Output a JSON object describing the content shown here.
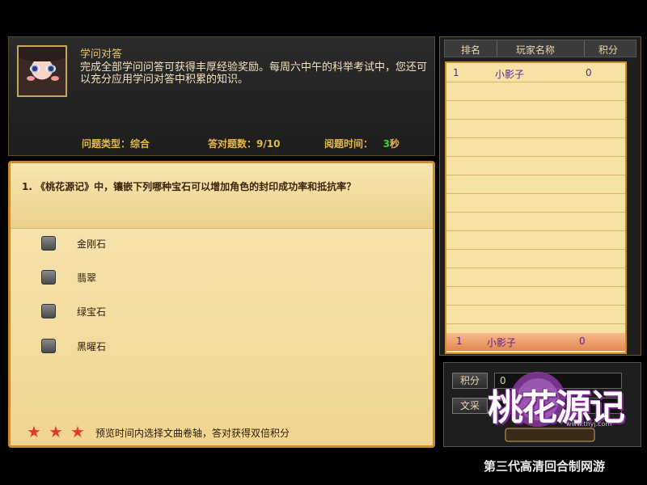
{
  "info": {
    "title": "学问对答",
    "description": "完成全部学问问答可获得丰厚经验奖励。每周六中午的科举考试中，您还可以充分应用学问对答中积累的知识。",
    "type_label": "问题类型：综合",
    "answered_label": "答对题数：9/10",
    "time_label": "阅题时间：",
    "time_value": "3",
    "time_unit": "秒"
  },
  "question": {
    "text": "1.  《桃花源记》中，镶嵌下列哪种宝石可以增加角色的封印成功率和抵抗率？",
    "options": [
      "金刚石",
      "翡翠",
      "绿宝石",
      "黑曜石"
    ],
    "tip": "预览时间内选择文曲卷轴，答对获得双倍积分",
    "star_icon": "star-icon"
  },
  "ranking": {
    "headers": [
      "排名",
      "玩家名称",
      "积分"
    ],
    "rows": [
      {
        "rank": "1",
        "name": "小影子",
        "score": "0"
      }
    ],
    "self": {
      "rank": "1",
      "name": "小影子",
      "score": "0"
    }
  },
  "side": {
    "score_button": "积分",
    "score_value": "0",
    "wenqu_button": "文采"
  },
  "brand": {
    "logo_text": "桃花源记",
    "logo_url": "www.thyj.com",
    "slogan": "第三代高清回合制网游"
  },
  "colors": {
    "accent_gold": "#e5b84a",
    "time_green": "#3ccf3c",
    "name_purple": "#5a1c9a",
    "star_red": "#e04020"
  }
}
